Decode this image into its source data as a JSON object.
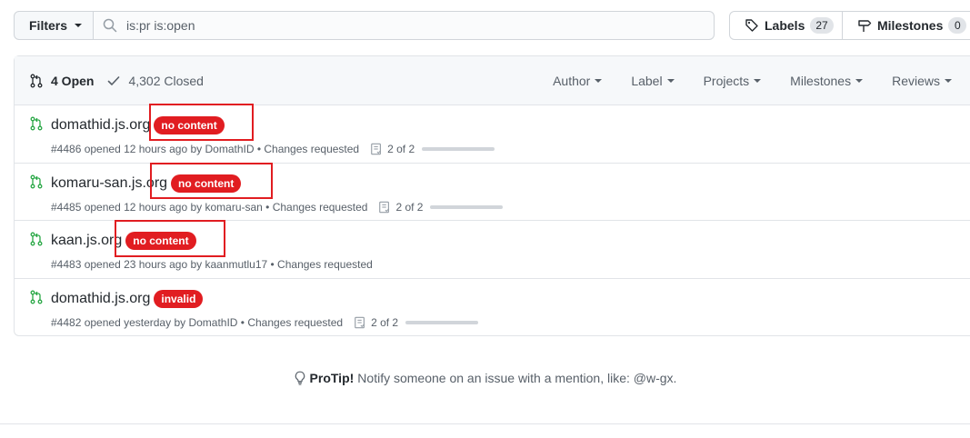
{
  "toolbar": {
    "filters_label": "Filters",
    "search_value": "is:pr is:open",
    "labels_label": "Labels",
    "labels_count": "27",
    "milestones_label": "Milestones",
    "milestones_count": "0"
  },
  "list_header": {
    "open_label": "4 Open",
    "closed_label": "4,302 Closed",
    "filters": [
      "Author",
      "Label",
      "Projects",
      "Milestones",
      "Reviews"
    ]
  },
  "pull_requests": [
    {
      "title": "domathid.js.org",
      "label": "no content",
      "meta": "#4486 opened 12 hours ago by DomathID • Changes requested",
      "checks": "2 of 2"
    },
    {
      "title": "komaru-san.js.org",
      "label": "no content",
      "meta": "#4485 opened 12 hours ago by komaru-san • Changes requested",
      "checks": "2 of 2"
    },
    {
      "title": "kaan.js.org",
      "label": "no content",
      "meta": "#4483 opened 23 hours ago by kaanmutlu17 • Changes requested",
      "checks": ""
    },
    {
      "title": "domathid.js.org",
      "label": "invalid",
      "meta": "#4482 opened yesterday by DomathID • Changes requested",
      "checks": "2 of 2"
    }
  ],
  "protip": {
    "lead": "ProTip!",
    "text": "Notify someone on an issue with a mention, like: @w-gx."
  },
  "colors": {
    "label_red": "#e11d21",
    "pr_open_green": "#28a745",
    "highlight_red": "#e11d21"
  }
}
